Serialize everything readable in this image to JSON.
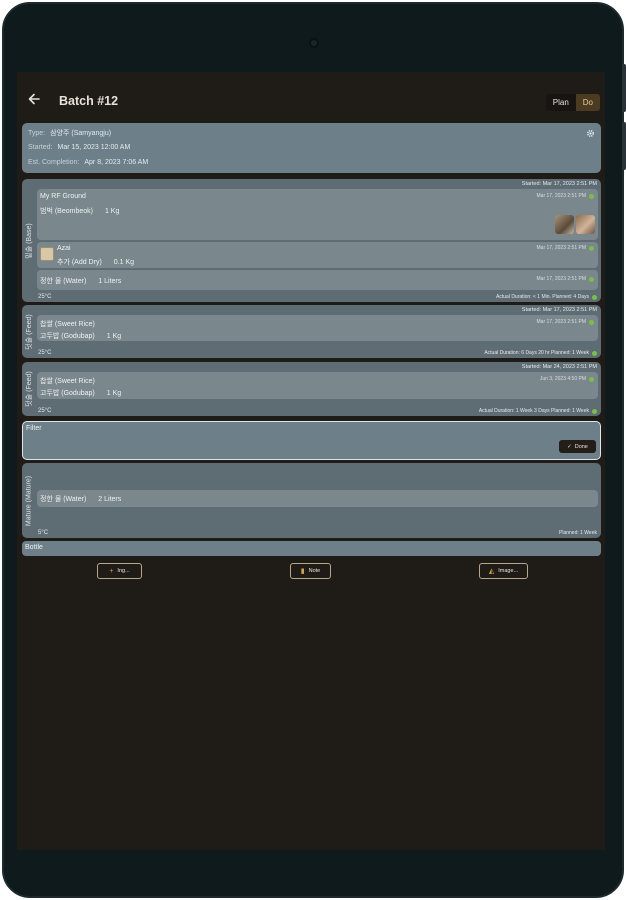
{
  "app": {
    "title": "Batch #12",
    "mode_plan": "Plan",
    "mode_do": "Do"
  },
  "info": {
    "type_label": "Type:",
    "type_value": "삼양주 (Samyangju)",
    "started_label": "Started:",
    "started_value": "Mar 15, 2023 12:00 AM",
    "est_label": "Est. Completion:",
    "est_value": "Apr 8, 2023 7:06 AM"
  },
  "stages": [
    {
      "label": "밑술 (Base)",
      "started": "Started: Mar 17, 2023 2:51 PM",
      "ingredients": [
        {
          "name": "My RF Ground",
          "line2": "범벅 (Beombeok)",
          "qty": "1 Kg",
          "ts": "Mar 17, 2023 2:51 PM"
        },
        {
          "name": "Azai",
          "line2": "추가 (Add Dry)",
          "qty": "0.1 Kg",
          "ts": "Mar 17, 2023 2:51 PM"
        },
        {
          "name": "정한 물 (Water)",
          "qty": "1 Liters",
          "ts": "Mar 17, 2023 2:51 PM"
        }
      ],
      "temp": "25°C",
      "duration": "Actual Duration: < 1 Min.  Planned: 4 Days"
    },
    {
      "label": "덧술 (Feed)",
      "started": "Started: Mar 17, 2023 2:51 PM",
      "ingredients": [
        {
          "name": "찹쌀 (Sweet Rice)",
          "line2": "고두밥 (Godubap)",
          "qty": "1 Kg",
          "ts": "Mar 17, 2023 2:51 PM"
        }
      ],
      "temp": "25°C",
      "duration": "Actual Duration: 6 Days 20 hr  Planned: 1 Week"
    },
    {
      "label": "덧술 (Feed)",
      "started": "Started: Mar 24, 2023 2:51 PM",
      "ingredients": [
        {
          "name": "찹쌀 (Sweet Rice)",
          "line2": "고두밥 (Godubap)",
          "qty": "1 Kg",
          "ts": "Jun 3, 2023 4:50 PM"
        }
      ],
      "temp": "25°C",
      "duration": "Actual Duration: 1 Week 3 Days  Planned: 1 Week"
    },
    {
      "label": "Mature (Mature)",
      "ingredients": [
        {
          "name": "정한 물 (Water)",
          "qty": "2 Liters"
        }
      ],
      "temp": "5°C",
      "duration": "Planned: 1 Week"
    }
  ],
  "filter": {
    "label": "Filter",
    "done": "Done"
  },
  "bottle": {
    "label": "Bottle"
  },
  "actions": {
    "ingredient": "Ing...",
    "note": "Note",
    "image": "Image..."
  },
  "icons": {
    "back": "arrow-back-icon",
    "gear": "gear-icon",
    "check": "check-icon",
    "dot": "status-dot-icon"
  },
  "colors": {
    "accent": "#4a3b21",
    "status_ok": "#7bc043",
    "card": "#6d8089"
  }
}
